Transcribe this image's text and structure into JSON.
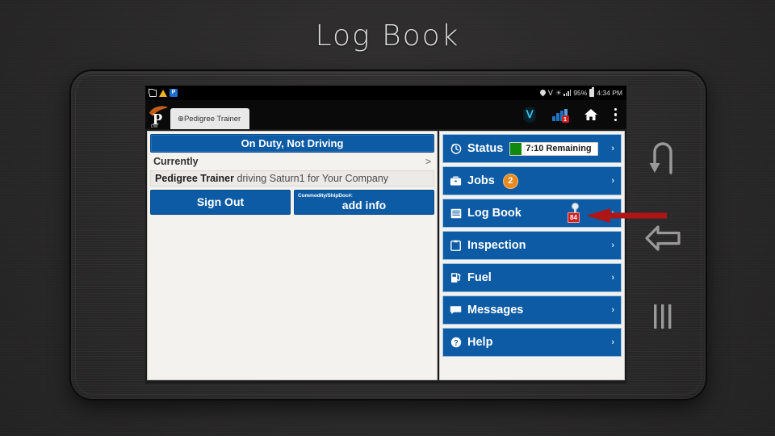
{
  "slide": {
    "title": "Log Book"
  },
  "device": {
    "name": "android-tablet",
    "nav_buttons": [
      {
        "name": "rotate-back-icon",
        "glyph": "u-turn"
      },
      {
        "name": "back-icon",
        "glyph": "left-arrow-outline"
      },
      {
        "name": "recents-icon",
        "glyph": "three-bars"
      }
    ]
  },
  "status_bar": {
    "left_icons": [
      "screenshot-icon",
      "warning-triangle-icon",
      "pedigree-app-icon"
    ],
    "right_icons": [
      "location-pin-icon",
      "bluetooth-icon",
      "wifi-icon",
      "cell-signal-icon"
    ],
    "battery_percent": "95%",
    "clock": "4:34 PM"
  },
  "app_bar": {
    "logo_letter": "P",
    "logo_sub": "DW",
    "tab_label": "⊕Pedigree Trainer",
    "actions": [
      "bluetooth-icon",
      "signal-strength-icon",
      "home-icon",
      "overflow-menu-icon"
    ],
    "signal_badge": "1"
  },
  "left_panel": {
    "duty_status": "On Duty, Not Driving",
    "currently_label": "Currently",
    "currently_chevron": ">",
    "driver_name": "Pedigree Trainer",
    "driver_detail": " driving Saturn1 for Your Company",
    "sign_out_label": "Sign Out",
    "add_info_caption": "Commodity/ShipDoc#:",
    "add_info_label": "add info"
  },
  "menu": {
    "chevron": "›",
    "items": [
      {
        "id": "status",
        "label": "Status",
        "icon": "clock-icon",
        "pill_text": "7:10 Remaining",
        "pill_swatch_color": "#0f8a0f"
      },
      {
        "id": "jobs",
        "label": "Jobs",
        "icon": "briefcase-icon",
        "badge": "2",
        "badge_color": "#e8881e"
      },
      {
        "id": "log-book",
        "label": "Log Book",
        "icon": "list-lines-icon",
        "indicator_badge": "84",
        "indicator_badge_color": "#d11f1f",
        "highlighted": true
      },
      {
        "id": "inspection",
        "label": "Inspection",
        "icon": "clipboard-icon"
      },
      {
        "id": "fuel",
        "label": "Fuel",
        "icon": "fuel-pump-icon"
      },
      {
        "id": "messages",
        "label": "Messages",
        "icon": "speech-bubble-icon"
      },
      {
        "id": "help",
        "label": "Help",
        "icon": "question-circle-icon"
      }
    ]
  },
  "annotation": {
    "arrow_color": "#b01515",
    "points_to": "log-book"
  },
  "colors": {
    "primary_blue": "#0c5ba4",
    "panel_bg": "#f4f2ee",
    "slide_bg": "#2b2b2b",
    "accent_orange": "#e8881e",
    "accent_red": "#d11f1f",
    "accent_green": "#0f8a0f"
  }
}
